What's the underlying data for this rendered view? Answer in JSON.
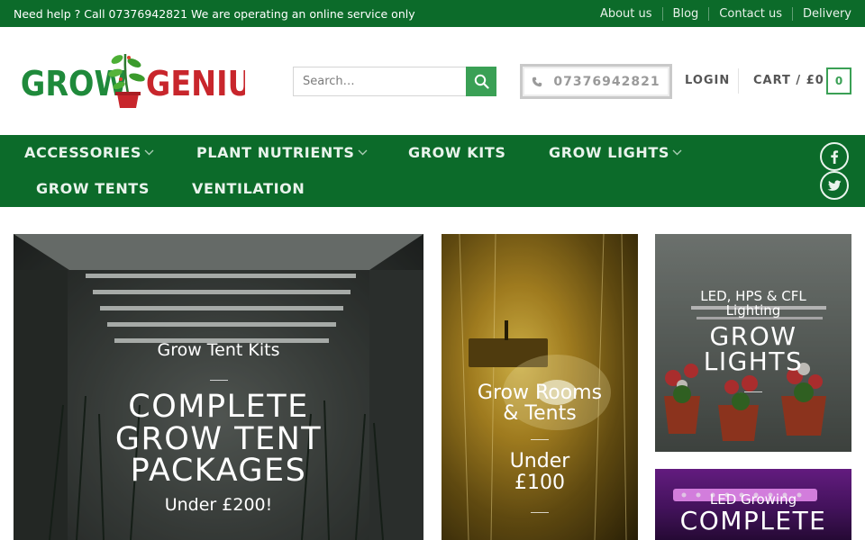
{
  "topbar": {
    "help_text": "Need help ? Call 07376942821 We are operating an online service only",
    "links": [
      "About us",
      "Blog",
      "Contact us",
      "Delivery"
    ]
  },
  "header": {
    "logo_text_left": "GROW",
    "logo_text_right": "GENIUS",
    "search_placeholder": "Search…",
    "phone": "07376942821",
    "login": "LOGIN",
    "cart_label": "CART / £0",
    "cart_count": "0"
  },
  "nav": {
    "items": [
      {
        "label": "ACCESSORIES",
        "dropdown": true
      },
      {
        "label": "PLANT NUTRIENTS",
        "dropdown": true
      },
      {
        "label": "GROW KITS",
        "dropdown": false
      },
      {
        "label": "GROW LIGHTS",
        "dropdown": true
      },
      {
        "label": "GROW TENTS",
        "dropdown": false
      },
      {
        "label": "VENTILATION",
        "dropdown": false
      }
    ],
    "social": [
      "facebook-icon",
      "twitter-icon"
    ]
  },
  "tiles": [
    {
      "subtitle": "Grow Tent Kits",
      "title": "COMPLETE GROW TENT PACKAGES",
      "tagline": "Under £200!"
    },
    {
      "title": "Grow Rooms & Tents",
      "tagline": "Under £100"
    },
    {
      "subtitle": "LED, HPS & CFL Lighting",
      "title": "GROW LIGHTS"
    },
    {
      "subtitle": "LED Growing",
      "title": "COMPLETE"
    }
  ],
  "colors": {
    "brand_green": "#0c6b2a",
    "accent_green": "#3aa055",
    "logo_red": "#c8262c"
  }
}
